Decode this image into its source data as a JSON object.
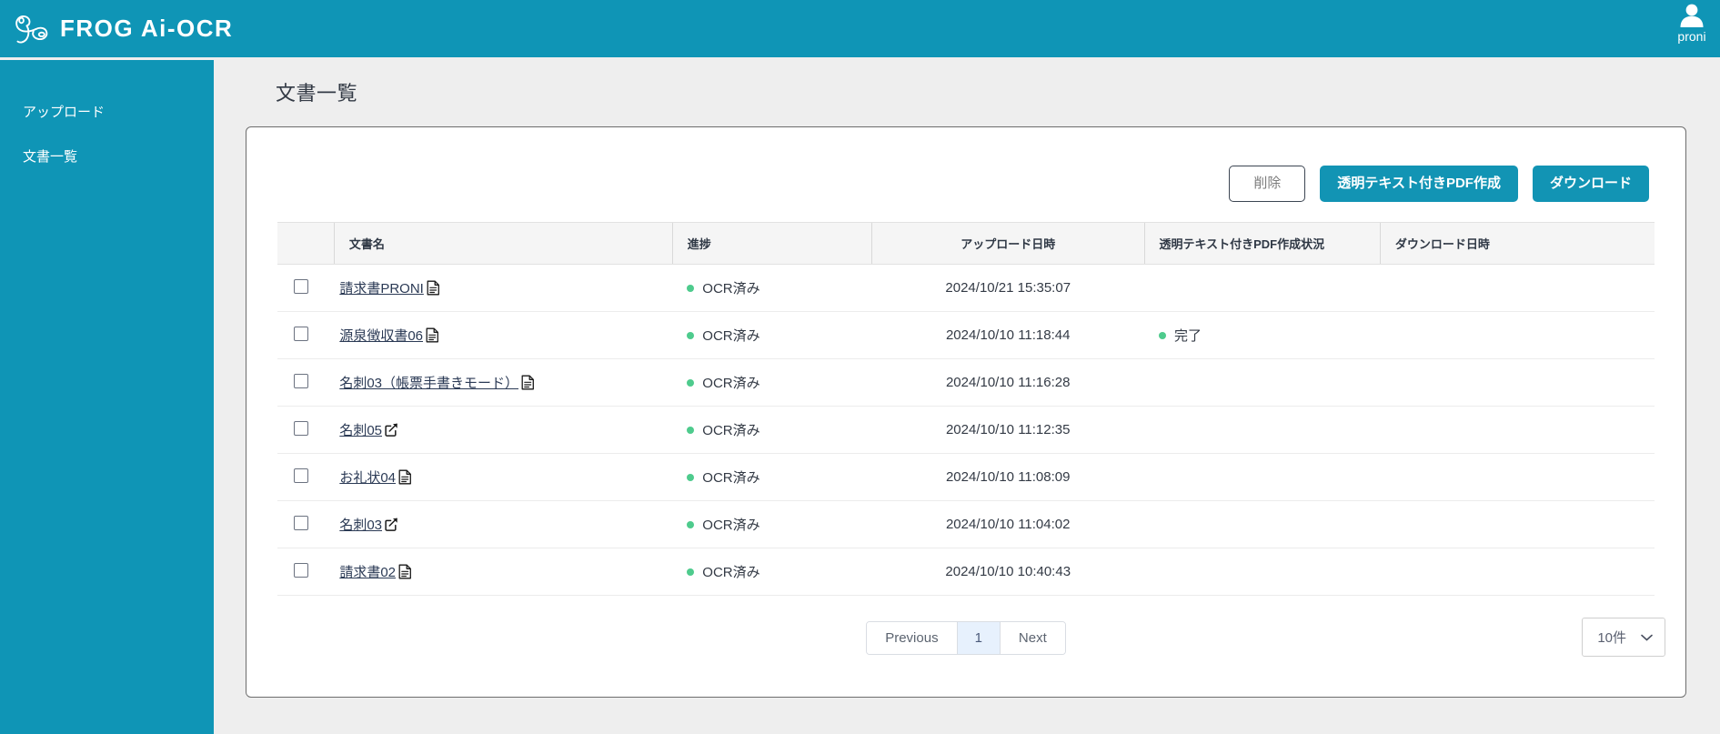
{
  "brand": {
    "name": "FROG Ai-OCR",
    "logo_icon": "frog-logo-icon"
  },
  "user": {
    "name": "proni",
    "icon": "person-icon"
  },
  "sidebar": {
    "items": [
      {
        "label": "アップロード"
      },
      {
        "label": "文書一覧"
      }
    ]
  },
  "page": {
    "title": "文書一覧"
  },
  "toolbar": {
    "delete_label": "削除",
    "create_pdf_label": "透明テキスト付きPDF作成",
    "download_label": "ダウンロード"
  },
  "table": {
    "headers": {
      "check": "",
      "name": "文書名",
      "progress": "進捗",
      "uploaded": "アップロード日時",
      "pdf_status": "透明テキスト付きPDF作成状況",
      "downloaded": "ダウンロード日時"
    },
    "rows": [
      {
        "name": "請求書PRONI",
        "icon": "file-icon",
        "progress": "OCR済み",
        "uploaded": "2024/10/21 15:35:07",
        "pdf_status": "",
        "downloaded": ""
      },
      {
        "name": "源泉徴収書06",
        "icon": "file-icon",
        "progress": "OCR済み",
        "uploaded": "2024/10/10 11:18:44",
        "pdf_status": "完了",
        "downloaded": ""
      },
      {
        "name": "名刺03（帳票手書きモード）",
        "icon": "file-icon",
        "progress": "OCR済み",
        "uploaded": "2024/10/10 11:16:28",
        "pdf_status": "",
        "downloaded": ""
      },
      {
        "name": "名刺05",
        "icon": "edit-icon",
        "progress": "OCR済み",
        "uploaded": "2024/10/10 11:12:35",
        "pdf_status": "",
        "downloaded": ""
      },
      {
        "name": "お礼状04",
        "icon": "file-icon",
        "progress": "OCR済み",
        "uploaded": "2024/10/10 11:08:09",
        "pdf_status": "",
        "downloaded": ""
      },
      {
        "name": "名刺03",
        "icon": "edit-icon",
        "progress": "OCR済み",
        "uploaded": "2024/10/10 11:04:02",
        "pdf_status": "",
        "downloaded": ""
      },
      {
        "name": "請求書02",
        "icon": "file-icon",
        "progress": "OCR済み",
        "uploaded": "2024/10/10 10:40:43",
        "pdf_status": "",
        "downloaded": ""
      }
    ]
  },
  "pagination": {
    "previous_label": "Previous",
    "current_page": "1",
    "next_label": "Next",
    "per_page_label": "10件"
  },
  "colors": {
    "brand": "#0f95b6",
    "primary_button": "#1294b4",
    "status_dot": "#4ecb8d",
    "page_background": "#eeeeee",
    "active_page": "#e7f1fd"
  }
}
